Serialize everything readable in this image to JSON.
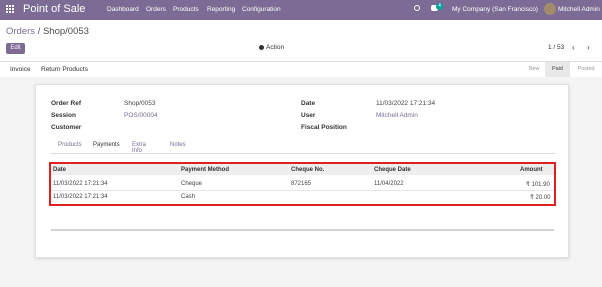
{
  "navbar": {
    "brand": "Point of Sale",
    "menu": [
      "Dashboard",
      "Orders",
      "Products",
      "Reporting",
      "Configuration"
    ],
    "chat_count": "4",
    "company": "My Company (San Francisco)",
    "user": "Mitchell Admin",
    "icons": [
      "apps-icon",
      "clock-icon",
      "chat-icon",
      "avatar"
    ]
  },
  "control": {
    "breadcrumb_parent": "Orders",
    "breadcrumb_sep": " / ",
    "breadcrumb_current": "Shop/0053",
    "edit_label": "Edit",
    "action_label": "Action",
    "pager": "1 / 53",
    "prev_glyph": "‹",
    "next_glyph": "›"
  },
  "statusbar": {
    "buttons": [
      "Invoice",
      "Return Products"
    ],
    "stages": [
      "New",
      "Paid",
      "Posted"
    ],
    "active_stage": "Paid"
  },
  "form": {
    "order_ref_label": "Order Ref",
    "order_ref": "Shop/0053",
    "session_label": "Session",
    "session": "POS/00004",
    "customer_label": "Customer",
    "customer": "",
    "date_label": "Date",
    "date": "11/03/2022 17:21:34",
    "user_label": "User",
    "user": "Mitchell Admin",
    "fiscal_label": "Fiscal Position",
    "fiscal": ""
  },
  "tabs": [
    "Products",
    "Payments",
    "Extra Info",
    "Notes"
  ],
  "active_tab": "Payments",
  "payments": {
    "columns": [
      "Date",
      "Payment Method",
      "Cheque No.",
      "Cheque Date",
      "Amount"
    ],
    "rows": [
      [
        "11/03/2022 17:21:34",
        "Cheque",
        "872165",
        "11/04/2022",
        "₹ 101.90"
      ],
      [
        "11/03/2022 17:21:34",
        "Cash",
        "",
        "",
        "₹ 20.00"
      ]
    ]
  },
  "colors": {
    "navbar": "#7c6b94",
    "accent": "#7c6b94",
    "highlight_border": "#e02020"
  }
}
